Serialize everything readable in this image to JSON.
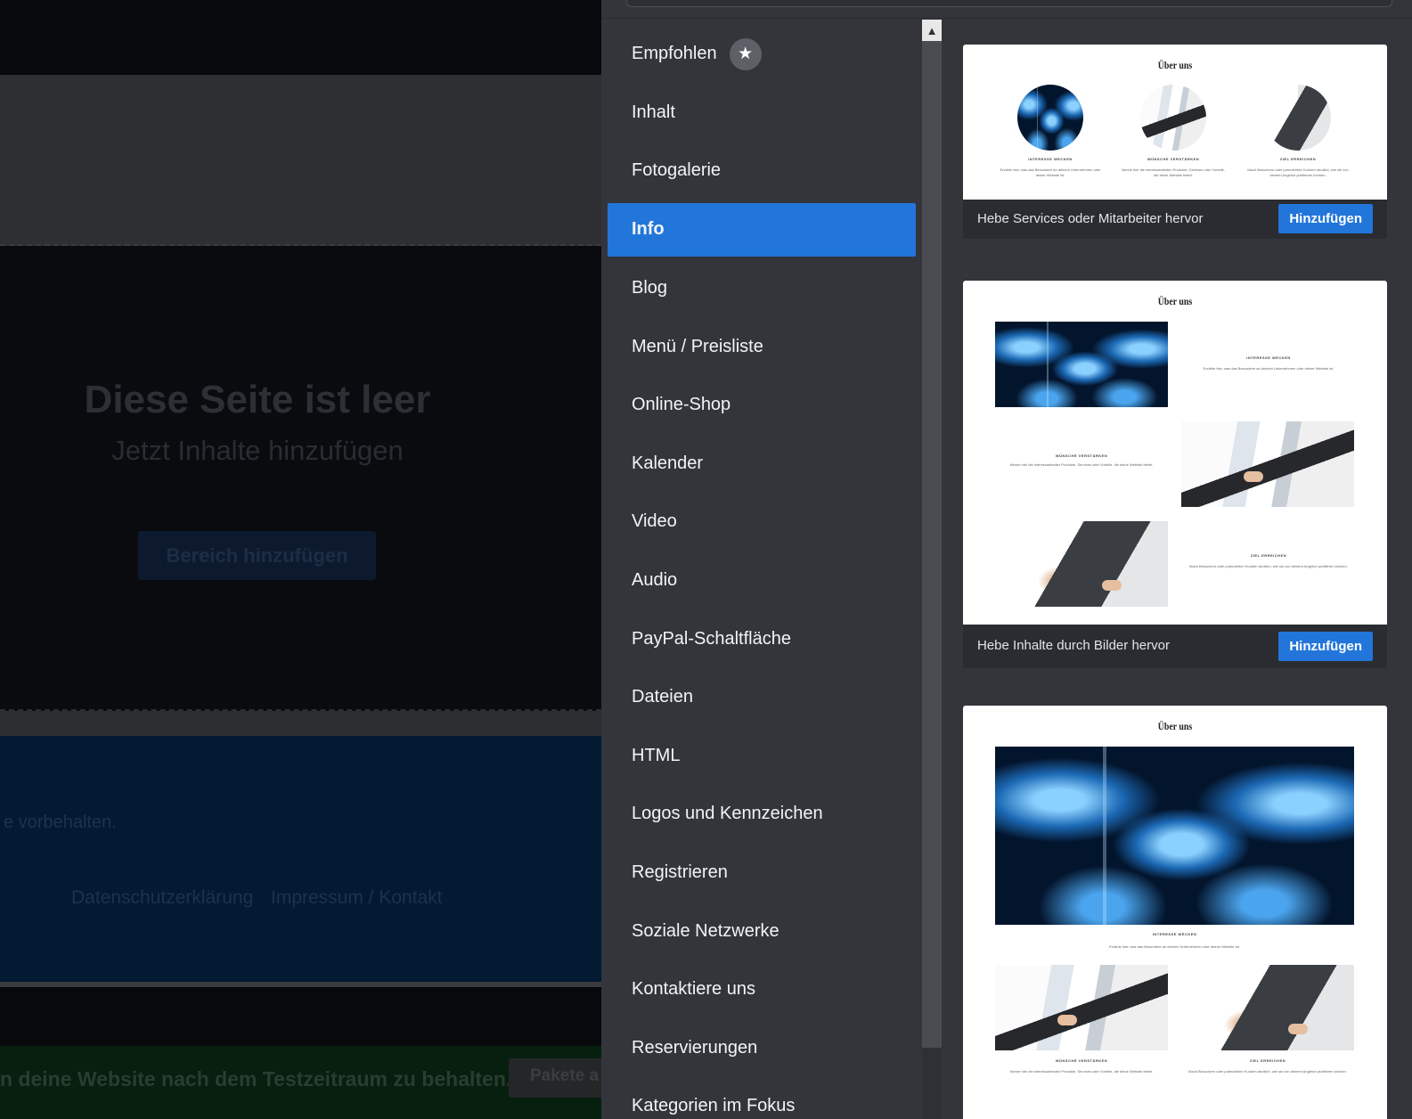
{
  "editor": {
    "empty_title": "Diese Seite ist leer",
    "empty_subtitle": "Jetzt Inhalte hinzufügen",
    "add_section_button": "Bereich hinzufügen",
    "footer_rights": "e vorbehalten.",
    "footer_links": [
      "Datenschutzerklärung",
      "Impressum / Kontakt"
    ],
    "trial_banner_text": "n deine Website nach dem Testzeitraum zu behalten.",
    "trial_banner_button": "Pakete a"
  },
  "categories": [
    {
      "label": "Empfohlen",
      "icon": "star-icon"
    },
    {
      "label": "Inhalt"
    },
    {
      "label": "Fotogalerie"
    },
    {
      "label": "Info",
      "active": true
    },
    {
      "label": "Blog"
    },
    {
      "label": "Menü / Preisliste"
    },
    {
      "label": "Online-Shop"
    },
    {
      "label": "Kalender"
    },
    {
      "label": "Video"
    },
    {
      "label": "Audio"
    },
    {
      "label": "PayPal-Schaltfläche"
    },
    {
      "label": "Dateien"
    },
    {
      "label": "HTML"
    },
    {
      "label": "Logos und Kennzeichen"
    },
    {
      "label": "Registrieren"
    },
    {
      "label": "Soziale Netzwerke"
    },
    {
      "label": "Kontaktiere uns"
    },
    {
      "label": "Reservierungen"
    },
    {
      "label": "Kategorien im Fokus"
    }
  ],
  "cards": [
    {
      "preview_title": "Über uns",
      "captions": [
        "INTERESSE WECKEN",
        "WÜNSCHE VERSTÄRKEN",
        "ZIEL ERREICHEN"
      ],
      "texts": [
        "Erzähle hier, was das Besondere an deinem Unternehmen oder deiner Website ist.",
        "Nenne hier die interessantesten Produkte, Services oder Vorteile, die deine Website bietet.",
        "Mach Besuchern oder potenziellen Kunden deutlich, wie sie von deinem Angebot profitieren können."
      ],
      "description": "Hebe Services oder Mitarbeiter hervor",
      "add_label": "Hinzufügen"
    },
    {
      "preview_title": "Über uns",
      "captions": [
        "INTERESSE WECKEN",
        "WÜNSCHE VERSTÄRKEN",
        "ZIEL ERREICHEN"
      ],
      "texts": [
        "Erzähle hier, was das Besondere an deinem Unternehmen oder deiner Website ist.",
        "Nenne hier die interessantesten Produkte, Services oder Vorteile, die deine Website bietet.",
        "Mach Besuchern oder potenziellen Kunden deutlich, wie sie von deinem Angebot profitieren können."
      ],
      "description": "Hebe Inhalte durch Bilder hervor",
      "add_label": "Hinzufügen"
    },
    {
      "preview_title": "Über uns",
      "captions": [
        "INTERESSE WECKEN",
        "WÜNSCHE VERSTÄRKEN",
        "ZIEL ERREICHEN"
      ],
      "texts": [
        "Erzähle hier, was das Besondere an deinem Unternehmen oder deiner Website ist.",
        "Nenne hier die interessantesten Produkte, Services oder Vorteile, die deine Website bietet.",
        "Mach Besuchern oder potenziellen Kunden deutlich, wie sie von deinem Angebot profitieren können."
      ]
    }
  ],
  "colors": {
    "accent": "#2276da",
    "panel_bg": "#33353b",
    "card_footer_bg": "#2a2c31"
  }
}
